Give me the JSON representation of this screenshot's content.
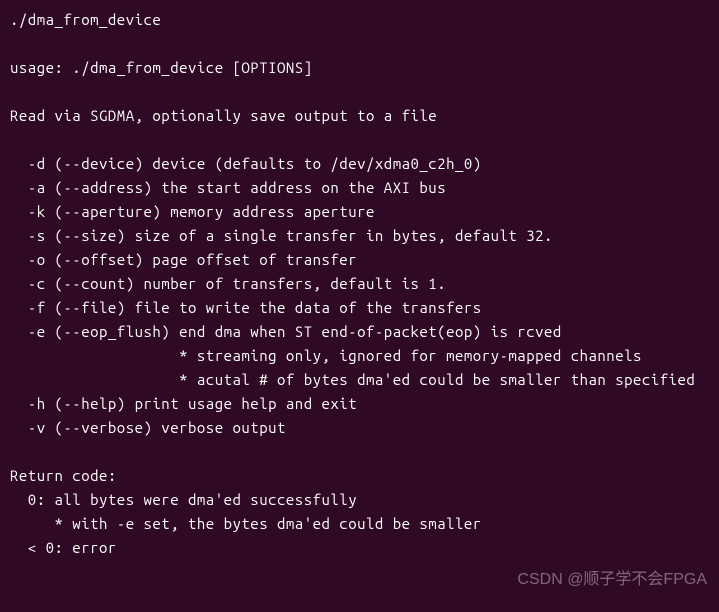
{
  "command": "./dma_from_device",
  "usage": "usage: ./dma_from_device [OPTIONS]",
  "description": "Read via SGDMA, optionally save output to a file",
  "options": {
    "d": "  -d (--device) device (defaults to /dev/xdma0_c2h_0)",
    "a": "  -a (--address) the start address on the AXI bus",
    "k": "  -k (--aperture) memory address aperture",
    "s": "  -s (--size) size of a single transfer in bytes, default 32.",
    "o": "  -o (--offset) page offset of transfer",
    "c": "  -c (--count) number of transfers, default is 1.",
    "f": "  -f (--file) file to write the data of the transfers",
    "e": "  -e (--eop_flush) end dma when ST end-of-packet(eop) is rcved",
    "e_n1": "                   * streaming only, ignored for memory-mapped channels",
    "e_n2": "                   * acutal # of bytes dma'ed could be smaller than specified",
    "h": "  -h (--help) print usage help and exit",
    "v": "  -v (--verbose) verbose output"
  },
  "return_code": {
    "header": "Return code:",
    "r0": "  0: all bytes were dma'ed successfully",
    "r0_n": "     * with -e set, the bytes dma'ed could be smaller",
    "rneg": "  < 0: error"
  },
  "watermark": "CSDN @顺子学不会FPGA"
}
